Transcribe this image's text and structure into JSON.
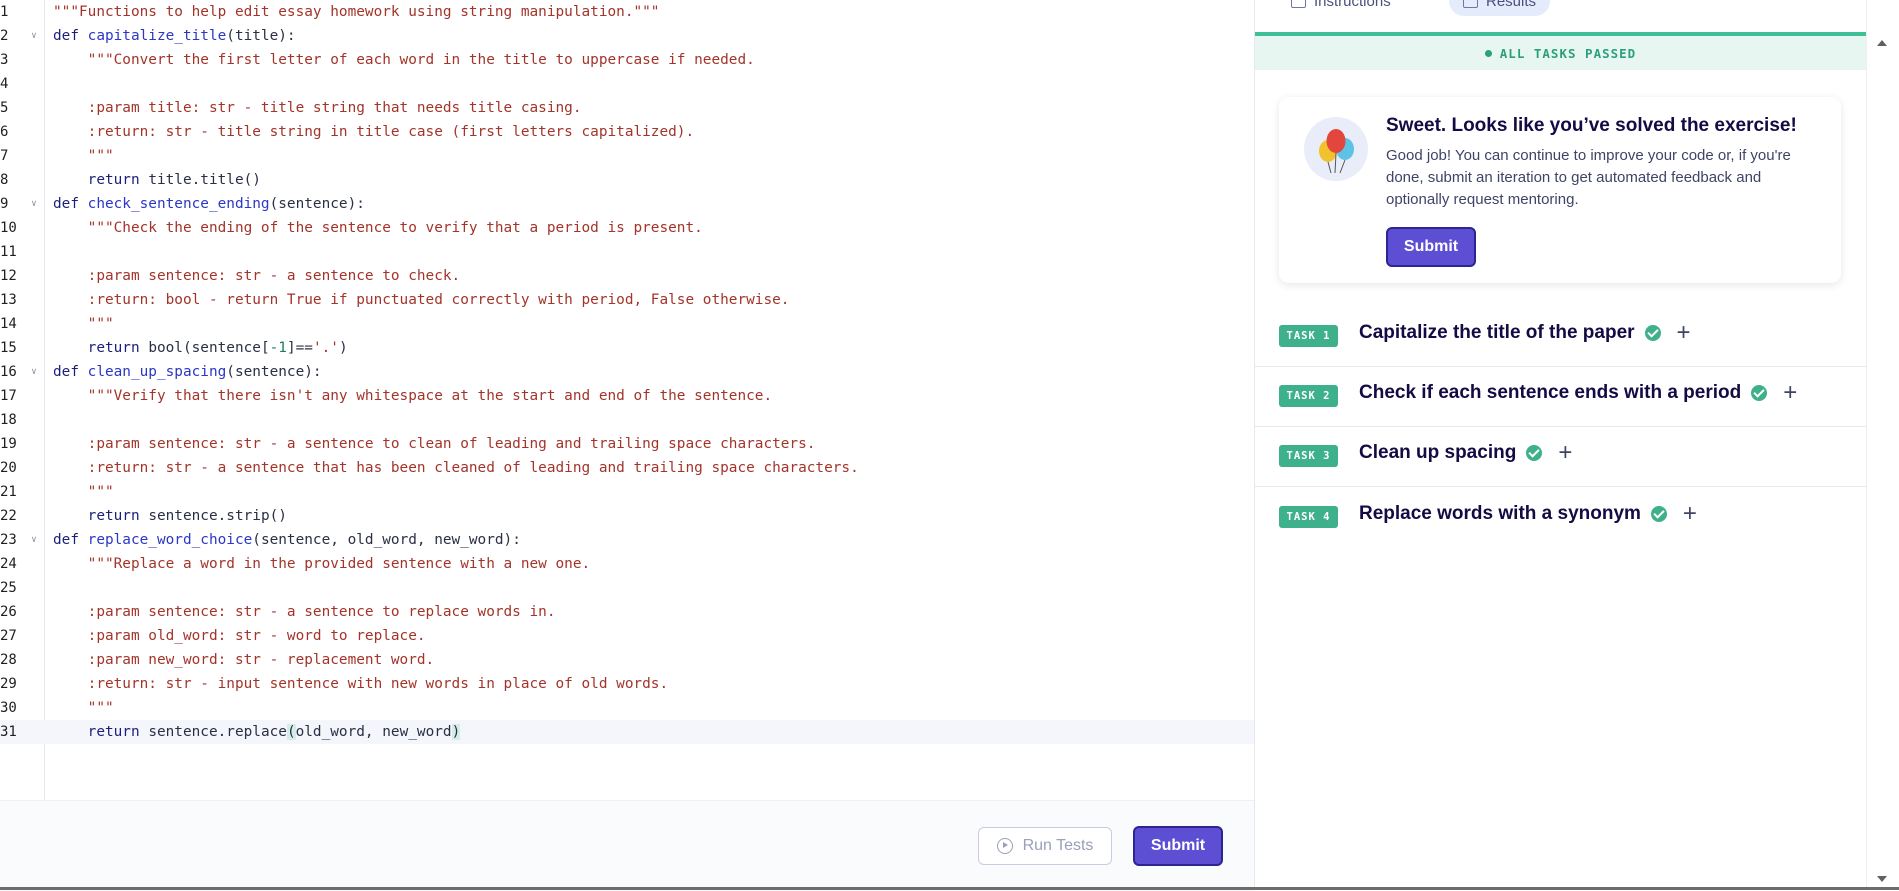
{
  "editor": {
    "lines": [
      {
        "n": "1",
        "tokens": [
          {
            "t": "\"\"\"Functions to help edit essay homework using string manipulation.\"\"\"",
            "c": "str"
          }
        ]
      },
      {
        "n": "2",
        "fold": true,
        "tokens": [
          {
            "t": "def ",
            "c": "kw"
          },
          {
            "t": "capitalize_title",
            "c": "fn"
          },
          {
            "t": "(title):",
            "c": "plain"
          }
        ]
      },
      {
        "n": "3",
        "tokens": [
          {
            "t": "    \"\"\"Convert the first letter of each word in the title to uppercase if needed.",
            "c": "str"
          }
        ]
      },
      {
        "n": "4",
        "tokens": []
      },
      {
        "n": "5",
        "tokens": [
          {
            "t": "    :param title: str - title string that needs title casing.",
            "c": "str"
          }
        ]
      },
      {
        "n": "6",
        "tokens": [
          {
            "t": "    :return: str - title string in title case (first letters capitalized).",
            "c": "str"
          }
        ]
      },
      {
        "n": "7",
        "tokens": [
          {
            "t": "    \"\"\"",
            "c": "str"
          }
        ]
      },
      {
        "n": "8",
        "tokens": [
          {
            "t": "    return ",
            "c": "kw"
          },
          {
            "t": "title.title()",
            "c": "plain"
          }
        ]
      },
      {
        "n": "9",
        "fold": true,
        "tokens": [
          {
            "t": "def ",
            "c": "kw"
          },
          {
            "t": "check_sentence_ending",
            "c": "fn"
          },
          {
            "t": "(sentence):",
            "c": "plain"
          }
        ]
      },
      {
        "n": "10",
        "tokens": [
          {
            "t": "    \"\"\"Check the ending of the sentence to verify that a period is present.",
            "c": "str"
          }
        ]
      },
      {
        "n": "11",
        "tokens": []
      },
      {
        "n": "12",
        "tokens": [
          {
            "t": "    :param sentence: str - a sentence to check.",
            "c": "str"
          }
        ]
      },
      {
        "n": "13",
        "tokens": [
          {
            "t": "    :return: bool - return True if punctuated correctly with period, False otherwise.",
            "c": "str"
          }
        ]
      },
      {
        "n": "14",
        "tokens": [
          {
            "t": "    \"\"\"",
            "c": "str"
          }
        ]
      },
      {
        "n": "15",
        "tokens": [
          {
            "t": "    return ",
            "c": "kw"
          },
          {
            "t": "bool(sentence[",
            "c": "plain"
          },
          {
            "t": "-1",
            "c": "num"
          },
          {
            "t": "]==",
            "c": "plain"
          },
          {
            "t": "'.'",
            "c": "str"
          },
          {
            "t": ")",
            "c": "plain"
          }
        ]
      },
      {
        "n": "16",
        "fold": true,
        "tokens": [
          {
            "t": "def ",
            "c": "kw"
          },
          {
            "t": "clean_up_spacing",
            "c": "fn"
          },
          {
            "t": "(sentence):",
            "c": "plain"
          }
        ]
      },
      {
        "n": "17",
        "tokens": [
          {
            "t": "    \"\"\"Verify that there isn't any whitespace at the start and end of the sentence.",
            "c": "str"
          }
        ]
      },
      {
        "n": "18",
        "tokens": []
      },
      {
        "n": "19",
        "tokens": [
          {
            "t": "    :param sentence: str - a sentence to clean of leading and trailing space characters.",
            "c": "str"
          }
        ]
      },
      {
        "n": "20",
        "tokens": [
          {
            "t": "    :return: str - a sentence that has been cleaned of leading and trailing space characters.",
            "c": "str"
          }
        ]
      },
      {
        "n": "21",
        "tokens": [
          {
            "t": "    \"\"\"",
            "c": "str"
          }
        ]
      },
      {
        "n": "22",
        "tokens": [
          {
            "t": "    return ",
            "c": "kw"
          },
          {
            "t": "sentence.strip()",
            "c": "plain"
          }
        ]
      },
      {
        "n": "23",
        "fold": true,
        "tokens": [
          {
            "t": "def ",
            "c": "kw"
          },
          {
            "t": "replace_word_choice",
            "c": "fn"
          },
          {
            "t": "(sentence, old_word, new_word):",
            "c": "plain"
          }
        ]
      },
      {
        "n": "24",
        "tokens": [
          {
            "t": "    \"\"\"Replace a word in the provided sentence with a new one.",
            "c": "str"
          }
        ]
      },
      {
        "n": "25",
        "tokens": []
      },
      {
        "n": "26",
        "tokens": [
          {
            "t": "    :param sentence: str - a sentence to replace words in.",
            "c": "str"
          }
        ]
      },
      {
        "n": "27",
        "tokens": [
          {
            "t": "    :param old_word: str - word to replace.",
            "c": "str"
          }
        ]
      },
      {
        "n": "28",
        "tokens": [
          {
            "t": "    :param new_word: str - replacement word.",
            "c": "str"
          }
        ]
      },
      {
        "n": "29",
        "tokens": [
          {
            "t": "    :return: str - input sentence with new words in place of old words.",
            "c": "str"
          }
        ]
      },
      {
        "n": "30",
        "tokens": [
          {
            "t": "    \"\"\"",
            "c": "str"
          }
        ]
      },
      {
        "n": "31",
        "active": true,
        "tokens": [
          {
            "t": "    return ",
            "c": "kw"
          },
          {
            "t": "sentence.replace",
            "c": "plain"
          },
          {
            "t": "(",
            "c": "plain hl"
          },
          {
            "t": "old_word, new_word",
            "c": "plain"
          },
          {
            "t": ")",
            "c": "plain hl"
          }
        ]
      }
    ]
  },
  "footer": {
    "run_tests_label": "Run Tests",
    "submit_label": "Submit"
  },
  "panel": {
    "tabs": [
      {
        "label": "Instructions"
      },
      {
        "label": "Results",
        "active": true
      }
    ],
    "status": "ALL TASKS PASSED",
    "success": {
      "title": "Sweet. Looks like you’ve solved the exercise!",
      "body": "Good job! You can continue to improve your code or, if you're done, submit an iteration to get automated feedback and optionally request mentoring.",
      "submit_label": "Submit"
    },
    "tasks": [
      {
        "badge": "TASK 1",
        "title": "Capitalize the title of the paper",
        "passed": true
      },
      {
        "badge": "TASK 2",
        "title": "Check if each sentence ends with a period",
        "passed": true
      },
      {
        "badge": "TASK 3",
        "title": "Clean up spacing",
        "passed": true
      },
      {
        "badge": "TASK 4",
        "title": "Replace words with a synonym",
        "passed": true
      }
    ]
  },
  "colors": {
    "accent": "#5c4fd3",
    "success": "#3fb08c",
    "string": "#a3342a",
    "function": "#2b37c6"
  }
}
